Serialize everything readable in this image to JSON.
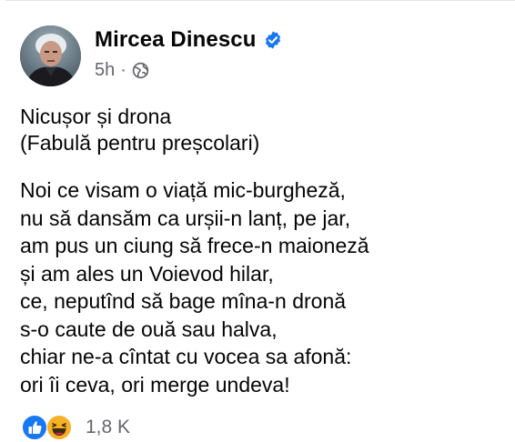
{
  "post": {
    "author": {
      "name": "Mircea Dinescu",
      "verified": true,
      "avatar": "author-avatar"
    },
    "meta": {
      "time": "5h",
      "separator": "·",
      "audience_icon": "globe-icon"
    },
    "title_lines": [
      "Nicușor și drona",
      "(Fabulă pentru preșcolari)"
    ],
    "poem_lines": [
      "Noi ce visam o viață mic-burgheză,",
      "nu să dansăm ca urșii-n lanț, pe jar,",
      "am pus un ciung să frece-n maioneză",
      "și am ales un Voievod hilar,",
      "ce, neputînd să bage mîna-n dronă",
      "s-o caute de ouă sau halva,",
      "chiar ne-a cîntat cu vocea sa afonă:",
      "ori îi ceva, ori merge undeva!"
    ],
    "reactions": {
      "icons": [
        "like-icon",
        "haha-icon"
      ],
      "count": "1,8 K"
    }
  },
  "colors": {
    "text_primary": "#050505",
    "text_secondary": "#65676b",
    "verified_blue": "#1877f2",
    "like_blue": "#1877f2",
    "haha_yellow": "#f7b125"
  }
}
